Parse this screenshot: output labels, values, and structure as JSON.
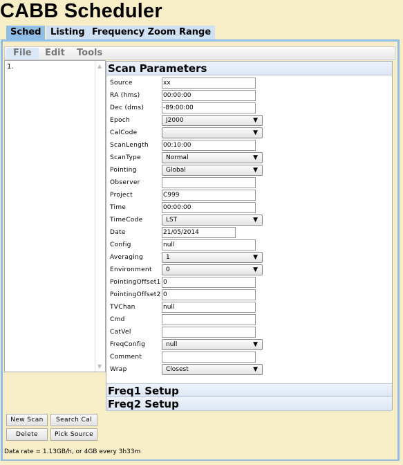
{
  "app_title": "CABB Scheduler",
  "tabs": [
    {
      "label": "Sched",
      "active": true
    },
    {
      "label": "Listing"
    },
    {
      "label": "Frequency Zoom Range"
    }
  ],
  "menu": [
    "File",
    "Edit",
    "Tools"
  ],
  "scan_list": [
    "1."
  ],
  "scan_parameters": {
    "title": "Scan Parameters",
    "fields": [
      {
        "label": "Source",
        "type": "input",
        "value": "xx"
      },
      {
        "label": "RA (hms)",
        "type": "input",
        "value": "00:00:00"
      },
      {
        "label": "Dec (dms)",
        "type": "input",
        "value": "-89:00:00"
      },
      {
        "label": "Epoch",
        "type": "select",
        "value": "J2000"
      },
      {
        "label": "CalCode",
        "type": "select",
        "value": ""
      },
      {
        "label": "ScanLength",
        "type": "input",
        "value": "00:10:00"
      },
      {
        "label": "ScanType",
        "type": "select",
        "value": "Normal"
      },
      {
        "label": "Pointing",
        "type": "select",
        "value": "Global"
      },
      {
        "label": "Observer",
        "type": "input",
        "value": ""
      },
      {
        "label": "Project",
        "type": "input",
        "value": "C999"
      },
      {
        "label": "Time",
        "type": "input",
        "value": "00:00:00"
      },
      {
        "label": "TimeCode",
        "type": "select",
        "value": "LST"
      },
      {
        "label": "Date",
        "type": "date",
        "value": "21/05/2014"
      },
      {
        "label": "Config",
        "type": "input",
        "value": "null"
      },
      {
        "label": "Averaging",
        "type": "select",
        "value": "1"
      },
      {
        "label": "Environment",
        "type": "select",
        "value": "0"
      },
      {
        "label": "PointingOffset1",
        "type": "input",
        "value": "0"
      },
      {
        "label": "PointingOffset2",
        "type": "input",
        "value": "0"
      },
      {
        "label": "TVChan",
        "type": "input",
        "value": "null"
      },
      {
        "label": "Cmd",
        "type": "input",
        "value": ""
      },
      {
        "label": "CatVel",
        "type": "input",
        "value": ""
      },
      {
        "label": "FreqConfig",
        "type": "select",
        "value": "null"
      },
      {
        "label": "Comment",
        "type": "input",
        "value": ""
      },
      {
        "label": "Wrap",
        "type": "select",
        "value": "Closest"
      }
    ]
  },
  "sections": {
    "freq1": "Freq1 Setup",
    "freq2": "Freq2 Setup"
  },
  "buttons": {
    "new_scan": "New Scan",
    "search_cal": "Search Cal",
    "delete": "Delete",
    "pick_source": "Pick Source"
  },
  "status": "Data rate = 1.13GB/h, or 4GB every 3h33m",
  "colors": {
    "background": "#f7eec8",
    "tab_active": "#8fbde6",
    "tab": "#cfe1f3"
  }
}
